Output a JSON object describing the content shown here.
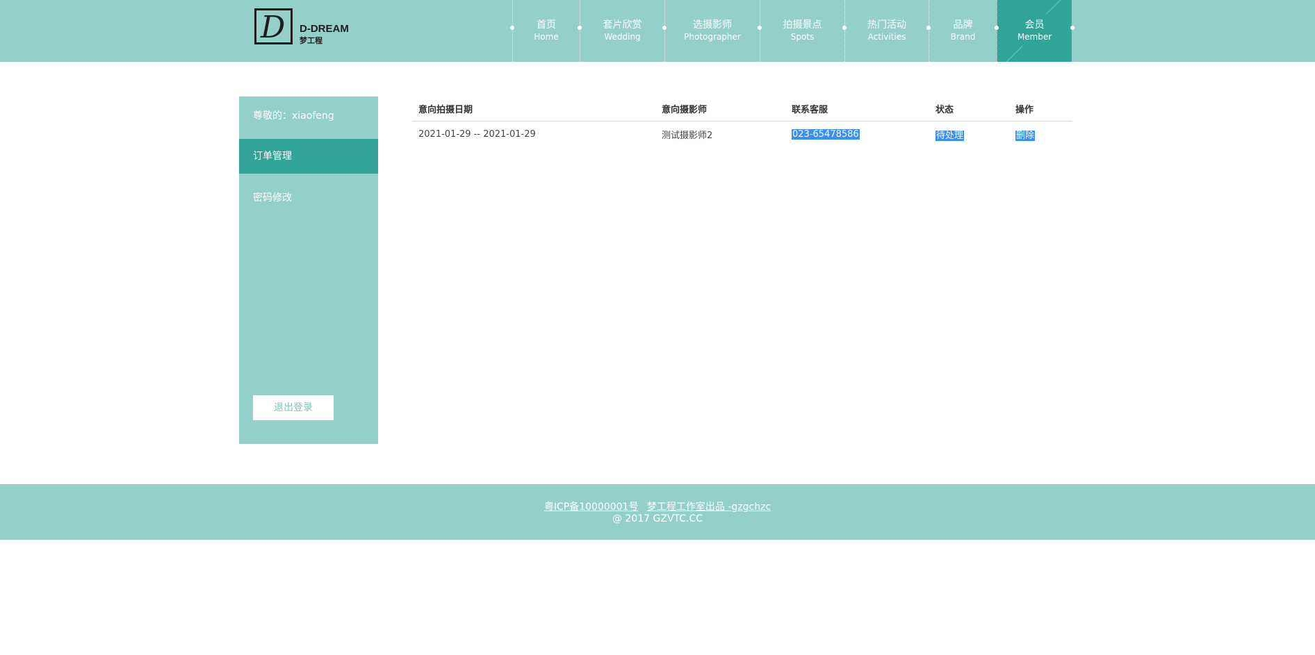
{
  "logo": {
    "text": "D-DREAM",
    "sub": "梦工程"
  },
  "nav": [
    {
      "zh": "首页",
      "en": "Home"
    },
    {
      "zh": "套片欣赏",
      "en": "Wedding"
    },
    {
      "zh": "选摄影师",
      "en": "Photographer"
    },
    {
      "zh": "拍摄景点",
      "en": "Spots"
    },
    {
      "zh": "热门活动",
      "en": "Activities"
    },
    {
      "zh": "品牌",
      "en": "Brand"
    },
    {
      "zh": "会员",
      "en": "Member"
    }
  ],
  "sidebar": {
    "greeting": "尊敬的：xiaofeng",
    "items": [
      {
        "label": "订单管理"
      },
      {
        "label": "密码修改"
      }
    ],
    "logout": "退出登录"
  },
  "table": {
    "headers": [
      "意向拍摄日期",
      "意向摄影师",
      "联系客服",
      "状态",
      "操作"
    ],
    "rows": [
      {
        "date": "2021-01-29 -- 2021-01-29",
        "photographer": "测试摄影师2",
        "contact": "023-65478586",
        "status": "待处理",
        "action": "删除"
      }
    ]
  },
  "footer": {
    "icp": "粤ICP备10000001号",
    "studio": "梦工程工作室出品 -gzgchzc",
    "copyright": "@ 2017 GZVTC.CC"
  },
  "colors": {
    "header_bg": "#92d0c9",
    "active": "#2fa597",
    "selection": "#3a8ff2"
  }
}
